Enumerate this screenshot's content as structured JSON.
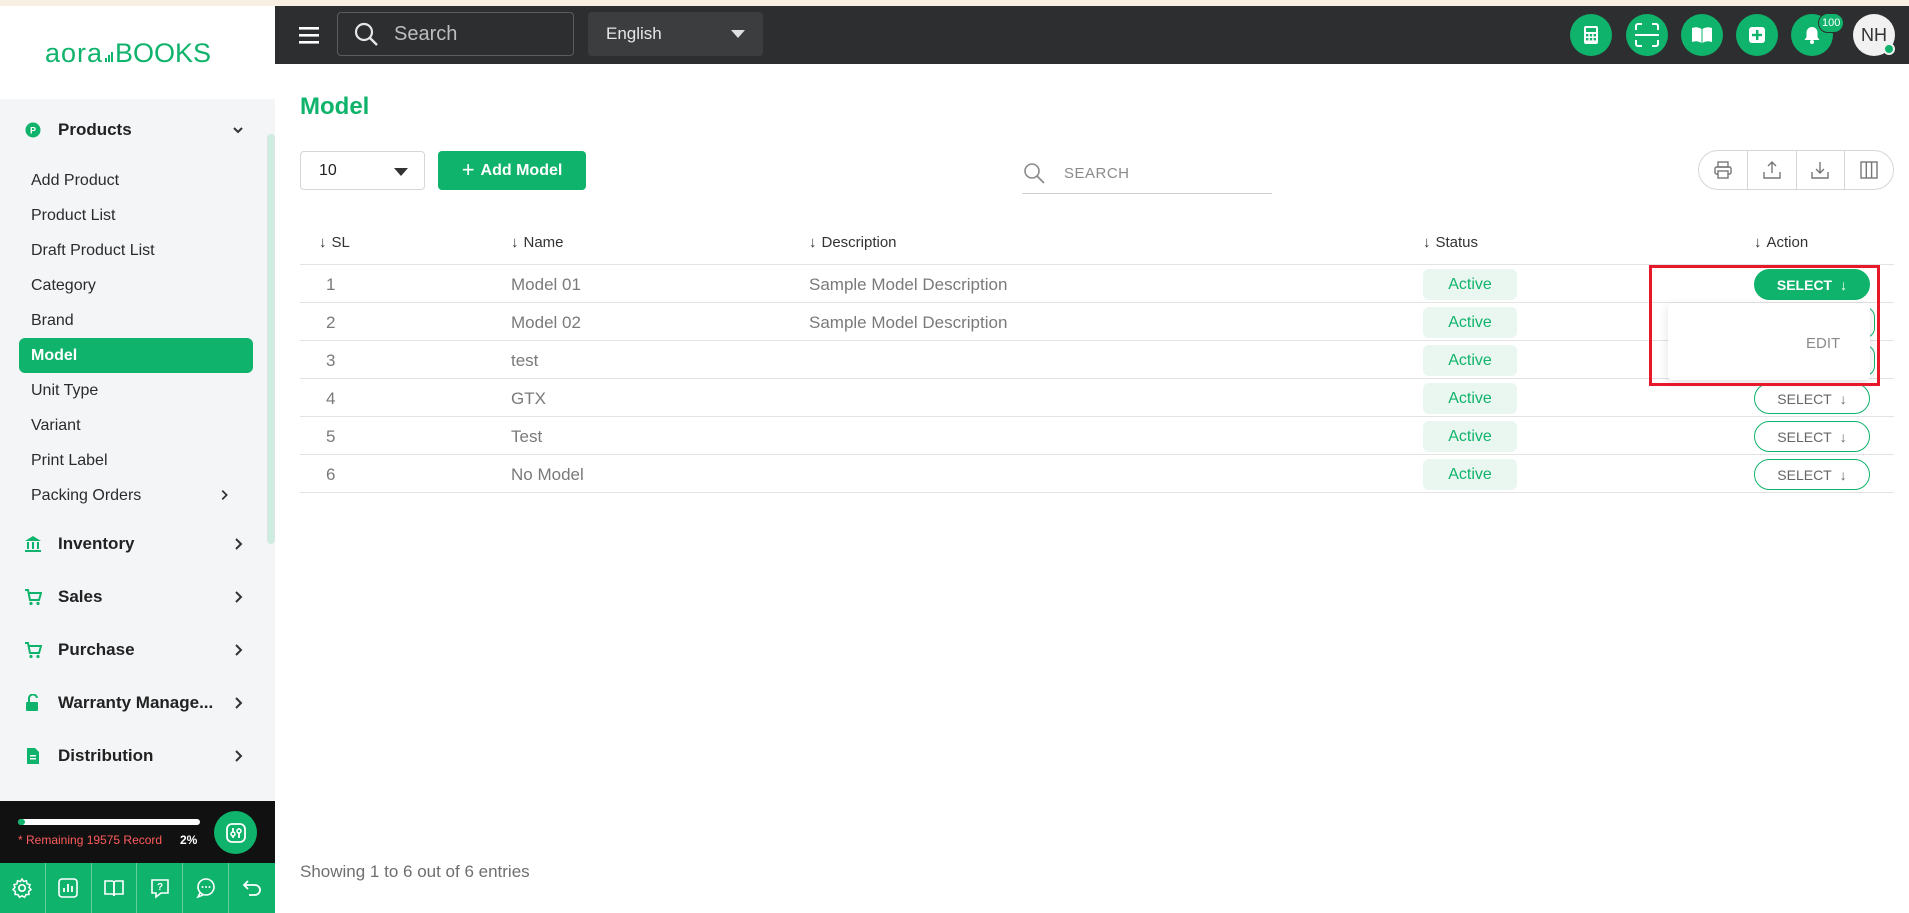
{
  "app": {
    "logo_text": "aoraBOOKS"
  },
  "sidebar": {
    "sections": [
      {
        "label": "Products",
        "icon": "products-icon",
        "expanded": true
      },
      {
        "label": "Inventory",
        "icon": "bank-icon"
      },
      {
        "label": "Sales",
        "icon": "cart-icon"
      },
      {
        "label": "Purchase",
        "icon": "cart-icon"
      },
      {
        "label": "Warranty Manage...",
        "icon": "unlock-icon"
      },
      {
        "label": "Distribution",
        "icon": "document-icon"
      }
    ],
    "items": [
      {
        "label": "Add Product"
      },
      {
        "label": "Product List"
      },
      {
        "label": "Draft Product List"
      },
      {
        "label": "Category"
      },
      {
        "label": "Brand"
      },
      {
        "label": "Model",
        "active": true
      },
      {
        "label": "Unit Type"
      },
      {
        "label": "Variant"
      },
      {
        "label": "Print Label"
      },
      {
        "label": "Packing Orders"
      }
    ],
    "usage": {
      "remaining_text": "* Remaining 19575 Record",
      "percent_text": "2%",
      "percent": 2
    }
  },
  "topbar": {
    "search_placeholder": "Search",
    "language": "English",
    "notification_count": "100",
    "avatar_initials": "NH"
  },
  "main": {
    "title": "Model",
    "per_page": "10",
    "add_button": "Add Model",
    "search_placeholder": "SEARCH",
    "columns": [
      "SL",
      "Name",
      "Description",
      "Status",
      "Action"
    ],
    "rows": [
      {
        "sl": "1",
        "name": "Model 01",
        "description": "Sample Model Description",
        "status": "Active",
        "action": "SELECT"
      },
      {
        "sl": "2",
        "name": "Model 02",
        "description": "Sample Model Description",
        "status": "Active",
        "action": "SELECT"
      },
      {
        "sl": "3",
        "name": "test",
        "description": "",
        "status": "Active",
        "action": "SELECT"
      },
      {
        "sl": "4",
        "name": "GTX",
        "description": "",
        "status": "Active",
        "action": "SELECT"
      },
      {
        "sl": "5",
        "name": "Test",
        "description": "",
        "status": "Active",
        "action": "SELECT"
      },
      {
        "sl": "6",
        "name": "No Model",
        "description": "",
        "status": "Active",
        "action": "SELECT"
      }
    ],
    "dropdown": {
      "edit_label": "EDIT"
    },
    "footer": "Showing 1 to 6 out of 6 entries"
  },
  "colors": {
    "accent": "#10b36b",
    "topbar": "#2c2e30",
    "highlight": "#e8182b"
  }
}
